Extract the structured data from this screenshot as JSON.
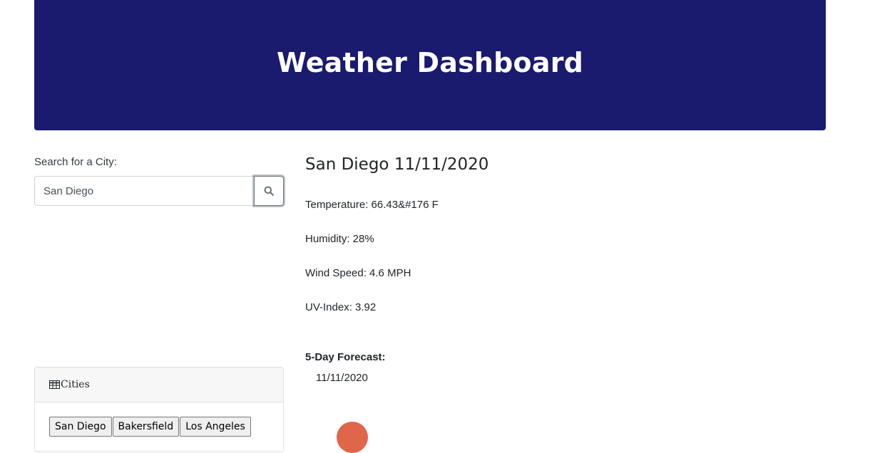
{
  "header": {
    "title": "Weather Dashboard"
  },
  "search": {
    "label": "Search for a City:",
    "value": "San Diego",
    "button_icon": "search-icon"
  },
  "cities_panel": {
    "header_icon": "table-icon",
    "title": "Cities",
    "buttons": [
      "San Diego",
      "Bakersfield",
      "Los Angeles"
    ]
  },
  "current": {
    "title": "San Diego 11/11/2020",
    "temperature": "Temperature: 66.43&#176 F",
    "humidity": "Humidity: 28%",
    "wind": "Wind Speed: 4.6 MPH",
    "uv": "UV-Index: 3.92"
  },
  "forecast": {
    "heading": "5-Day Forecast:",
    "days": [
      {
        "date": "11/11/2020",
        "icon": "weather-icon"
      }
    ]
  },
  "colors": {
    "header_bg": "#1a1a6e",
    "header_text": "#ffffff",
    "forecast_icon": "#e0664a"
  }
}
